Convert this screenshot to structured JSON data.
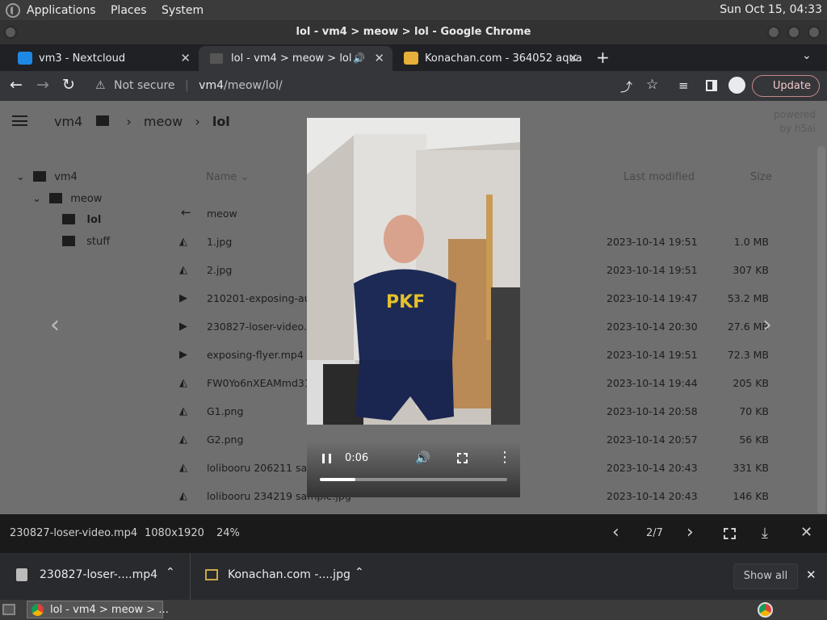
{
  "system": {
    "menus": [
      "Applications",
      "Places",
      "System"
    ],
    "clock": "Sun Oct 15, 04:33"
  },
  "window": {
    "title": "lol - vm4 > meow > lol - Google Chrome"
  },
  "tabs": [
    {
      "label": "vm3 - Nextcloud",
      "icon": "nextcloud-icon"
    },
    {
      "label": "lol - vm4 > meow > lol",
      "icon": "folder-icon",
      "active": true
    },
    {
      "label": "Konachan.com - 364052 aqua",
      "icon": "konachan-icon"
    }
  ],
  "omnibox": {
    "security": "Not secure",
    "url_host": "vm4",
    "url_path": "/meow/lol/",
    "update_label": "Update"
  },
  "breadcrumb": {
    "root": "vm4",
    "parts": [
      "meow",
      "lol"
    ]
  },
  "powered_by": {
    "line1": "powered",
    "line2": "by h5ai"
  },
  "tree": {
    "root": "vm4",
    "folder": "meow",
    "active": "lol",
    "other": "stuff"
  },
  "list": {
    "col_name": "Name",
    "col_modified": "Last modified",
    "col_size": "Size",
    "parent": "meow",
    "rows": [
      {
        "name": "1.jpg",
        "date": "2023-10-14 19:51",
        "size": "1.0 MB",
        "kind": "image"
      },
      {
        "name": "2.jpg",
        "date": "2023-10-14 19:51",
        "size": "307 KB",
        "kind": "image"
      },
      {
        "name": "210201-exposing-aub",
        "date": "2023-10-14 19:47",
        "size": "53.2 MB",
        "kind": "video"
      },
      {
        "name": "230827-loser-video.m",
        "date": "2023-10-14 20:30",
        "size": "27.6 MB",
        "kind": "video"
      },
      {
        "name": "exposing-flyer.mp4",
        "date": "2023-10-14 19:51",
        "size": "72.3 MB",
        "kind": "video"
      },
      {
        "name": "FW0Yo6nXEAMmd31",
        "date": "2023-10-14 19:44",
        "size": "205 KB",
        "kind": "image"
      },
      {
        "name": "G1.png",
        "date": "2023-10-14 20:58",
        "size": "70 KB",
        "kind": "image"
      },
      {
        "name": "G2.png",
        "date": "2023-10-14 20:57",
        "size": "56 KB",
        "kind": "image"
      },
      {
        "name": "lolibooru 206211 sam",
        "date": "2023-10-14 20:43",
        "size": "331 KB",
        "kind": "image"
      },
      {
        "name": "lolibooru 234219 sample.jpg",
        "date": "2023-10-14 20:43",
        "size": "146 KB",
        "kind": "image"
      }
    ]
  },
  "player": {
    "time": "0:06",
    "progress": 0.19,
    "shirt_text": "PKF"
  },
  "viewer": {
    "filename": "230827-loser-video.mp4",
    "resolution": "1080x1920",
    "zoom": "24%",
    "position": "2/7"
  },
  "downloads": {
    "items": [
      "230827-loser-....mp4",
      "Konachan.com -....jpg"
    ],
    "show_all": "Show all"
  },
  "taskbar": {
    "window_label": "lol - vm4 > meow > ..."
  }
}
